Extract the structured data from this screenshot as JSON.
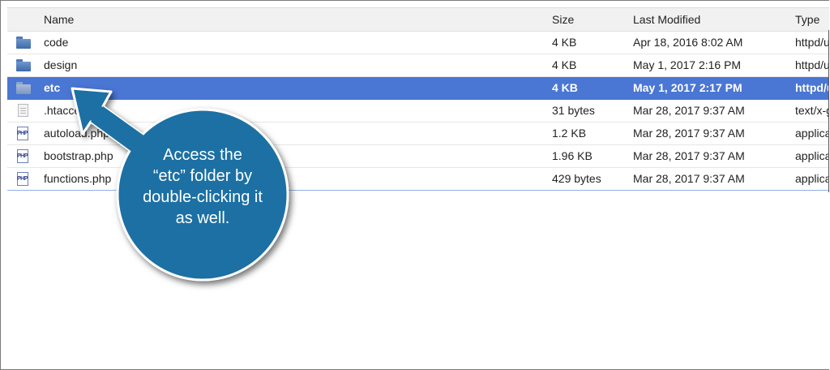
{
  "columns": {
    "name": "Name",
    "size": "Size",
    "last_modified": "Last Modified",
    "type": "Type"
  },
  "rows": [
    {
      "icon": "folder-icon",
      "name": "code",
      "size": "4 KB",
      "modified": "Apr 18, 2016 8:02 AM",
      "type": "httpd/unix-directory",
      "selected": false
    },
    {
      "icon": "folder-icon",
      "name": "design",
      "size": "4 KB",
      "modified": "May 1, 2017 2:16 PM",
      "type": "httpd/unix-directory",
      "selected": false
    },
    {
      "icon": "folder-icon",
      "name": "etc",
      "size": "4 KB",
      "modified": "May 1, 2017 2:17 PM",
      "type": "httpd/unix-directory",
      "selected": true
    },
    {
      "icon": "text-file-icon",
      "name": ".htaccess",
      "size": "31 bytes",
      "modified": "Mar 28, 2017 9:37 AM",
      "type": "text/x-generic",
      "selected": false
    },
    {
      "icon": "php-file-icon",
      "name": "autoload.php",
      "size": "1.2 KB",
      "modified": "Mar 28, 2017 9:37 AM",
      "type": "application/x-httpd-php",
      "selected": false
    },
    {
      "icon": "php-file-icon",
      "name": "bootstrap.php",
      "size": "1.96 KB",
      "modified": "Mar 28, 2017 9:37 AM",
      "type": "application/x-httpd-php",
      "selected": false
    },
    {
      "icon": "php-file-icon",
      "name": "functions.php",
      "size": "429 bytes",
      "modified": "Mar 28, 2017 9:37 AM",
      "type": "application/x-httpd-php",
      "selected": false
    }
  ],
  "callout": {
    "line1": "Access the",
    "line2": "“etc” folder by",
    "line3": "double-clicking it",
    "line4": "as well.",
    "color": "#1f6fa3"
  },
  "colors": {
    "selection": "#4a76d4",
    "header_bg": "#f1f1f1",
    "folder": "#4e79b5"
  },
  "icons": {
    "php_label": "PHP"
  }
}
